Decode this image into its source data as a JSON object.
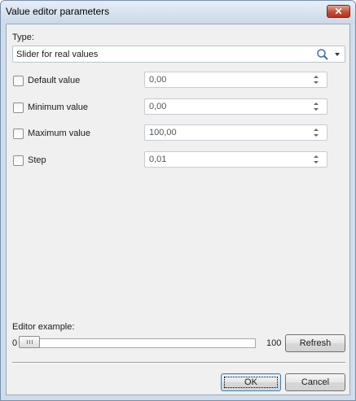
{
  "window": {
    "title": "Value editor parameters",
    "close_label": "✕"
  },
  "type_section": {
    "label": "Type:",
    "selected": "Slider for real values",
    "search_icon": "search-icon",
    "dropdown_icon": "chevron-down-icon"
  },
  "params": [
    {
      "label": "Default value",
      "value": "0,00",
      "checked": false
    },
    {
      "label": "Minimum value",
      "value": "0,00",
      "checked": false
    },
    {
      "label": "Maximum value",
      "value": "100,00",
      "checked": false
    },
    {
      "label": "Step",
      "value": "0,01",
      "checked": false
    }
  ],
  "example": {
    "label": "Editor example:",
    "min_label": "0",
    "max_label": "100",
    "position": 0.0,
    "refresh_label": "Refresh"
  },
  "buttons": {
    "ok_label": "OK",
    "cancel_label": "Cancel"
  },
  "colors": {
    "title_bar": "#cdd9e8",
    "close_button": "#c44c36",
    "dialog_bg": "#f0f0f0",
    "default_button_border": "#3c7fb1"
  }
}
